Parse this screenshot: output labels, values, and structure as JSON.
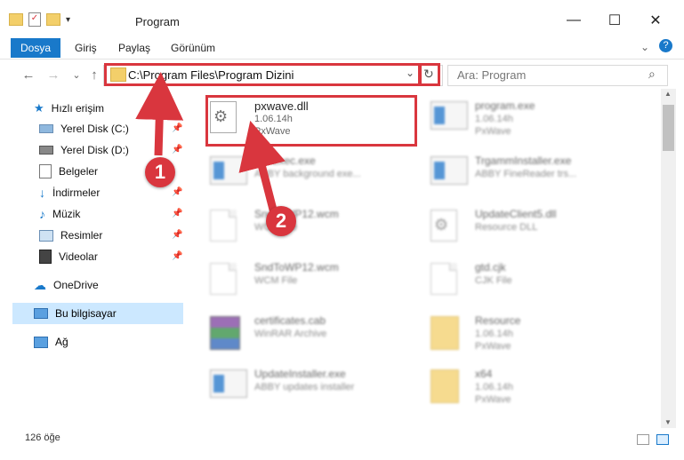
{
  "window": {
    "title": "Program",
    "minimize_glyph": "—",
    "maximize_glyph": "☐",
    "close_glyph": "✕"
  },
  "ribbon": {
    "tabs": [
      "Dosya",
      "Giriş",
      "Paylaş",
      "Görünüm"
    ]
  },
  "nav": {
    "back": "←",
    "forward": "→",
    "recent": "⌄",
    "up": "↑"
  },
  "address": {
    "path": "C:\\Program Files\\Program Dizini",
    "dropdown": "⌄",
    "refresh": "↻"
  },
  "search": {
    "placeholder": "Ara: Program",
    "icon": "⌕"
  },
  "sidebar": {
    "quick_access": "Hızlı erişim",
    "items": [
      "Yerel Disk (C:)",
      "Yerel Disk (D:)",
      "Belgeler",
      "İndirmeler",
      "Müzik",
      "Resimler",
      "Videolar"
    ],
    "onedrive": "OneDrive",
    "this_pc": "Bu bilgisayar",
    "network": "Ağ"
  },
  "files": {
    "highlighted": {
      "name": "pxwave.dll",
      "version": "1.06.14h",
      "company": "PxWave"
    },
    "col1": [
      {
        "name": "FileExec.exe",
        "desc": "ABBY background exe..."
      },
      {
        "name": "SndToWP12.wcm",
        "desc": "WCM File"
      },
      {
        "name": "SndToWP12.wcm",
        "desc": "WCM File"
      },
      {
        "name": "certificates.cab",
        "desc": "WinRAR Archive"
      },
      {
        "name": "UpdateInstaller.exe",
        "desc": "ABBY updates installer"
      }
    ],
    "col2": [
      {
        "name": "program.exe",
        "l2": "1.06.14h",
        "l3": "PxWave"
      },
      {
        "name": "TrgammInstaller.exe",
        "l2": "ABBY FineReader trs...",
        "l3": ""
      },
      {
        "name": "UpdateClient5.dll",
        "l2": "Resource DLL",
        "l3": ""
      },
      {
        "name": "gtd.cjk",
        "l2": "CJK File",
        "l3": ""
      },
      {
        "name": "Resource",
        "l2": "1.06.14h",
        "l3": "PxWave"
      },
      {
        "name": "x64",
        "l2": "1.06.14h",
        "l3": "PxWave"
      }
    ]
  },
  "status": {
    "count": "126 öğe"
  },
  "callouts": [
    "1",
    "2"
  ],
  "colors": {
    "accent": "#1979ca",
    "highlight_box": "#d9363e",
    "selected": "#cce8ff"
  }
}
